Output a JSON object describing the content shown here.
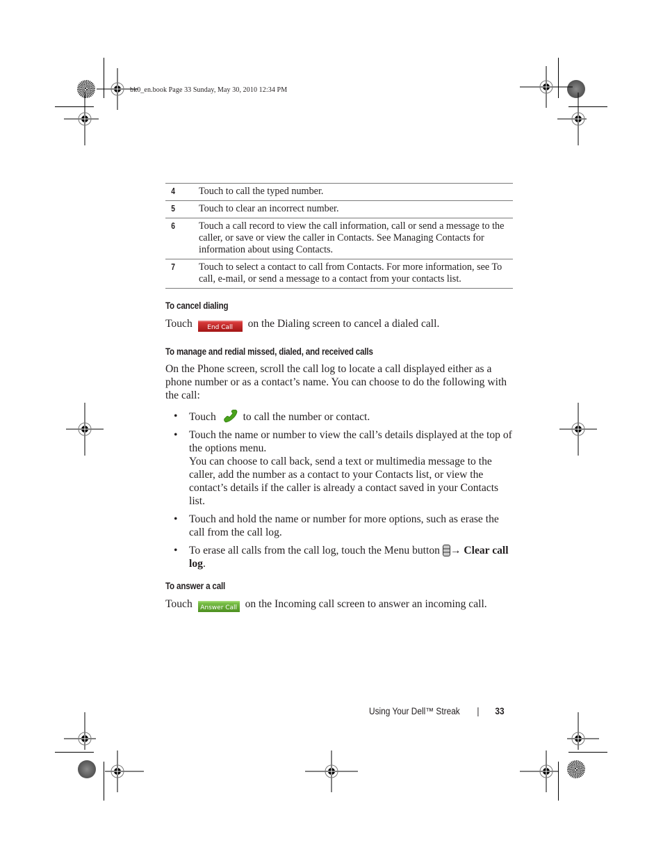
{
  "slug": {
    "text": "bk0_en.book  Page 33  Sunday, May 30, 2010  12:34 PM"
  },
  "legend_table": {
    "rows": [
      {
        "num": "4",
        "text": "Touch to call the typed number."
      },
      {
        "num": "5",
        "text": "Touch to clear an incorrect number."
      },
      {
        "num": "6",
        "text": "Touch a call record to view the call information, call or send a message to the caller, or save or view the caller in Contacts. See Managing Contacts for information about using Contacts."
      },
      {
        "num": "7",
        "text": "Touch to select a contact to call from Contacts. For more information, see To call, e-mail, or send a message to a contact from your contacts list."
      }
    ]
  },
  "sections": {
    "cancel": {
      "heading": "To cancel dialing",
      "pre": "Touch",
      "button_label": "End Call",
      "post": "on the Dialing screen to cancel a dialed call."
    },
    "manage": {
      "heading": "To manage and redial missed, dialed, and received calls",
      "intro": "On the Phone screen, scroll the call log to locate a call displayed either as a phone number or as a contact’s name. You can choose to do the following with the call:",
      "bullets": {
        "b1_pre": "Touch",
        "b1_post": "to call the number or contact.",
        "b2_line1": "Touch the name or number to view the call’s details displayed at the top of the options menu.",
        "b2_line2": "You can choose to call back, send a text or multimedia message to the caller, add the number as a contact to your Contacts list, or view the contact’s details if the caller is already a contact saved in your Contacts list.",
        "b3": "Touch and hold the name or number for more options, such as erase the call from the call log.",
        "b4_pre": "To erase all calls from the call log, touch the Menu button",
        "b4_arrow": "→",
        "b4_bold": "Clear call log",
        "b4_post": "."
      },
      "bullet_char": "•"
    },
    "answer": {
      "heading": "To answer a call",
      "pre": "Touch",
      "button_label": "Answer Call",
      "post": "on the Incoming call screen to answer an incoming call."
    }
  },
  "footer": {
    "title": "Using Your Dell™ Streak",
    "separator": "|",
    "page_number": "33"
  },
  "icons": {
    "phone": "green-phone-handset-icon",
    "menu": "menu-button-icon"
  },
  "colors": {
    "end_call": "#b52020",
    "answer_call": "#5ea52e",
    "phone_icon": "#4aa31c",
    "rule": "#7a7a7a"
  }
}
